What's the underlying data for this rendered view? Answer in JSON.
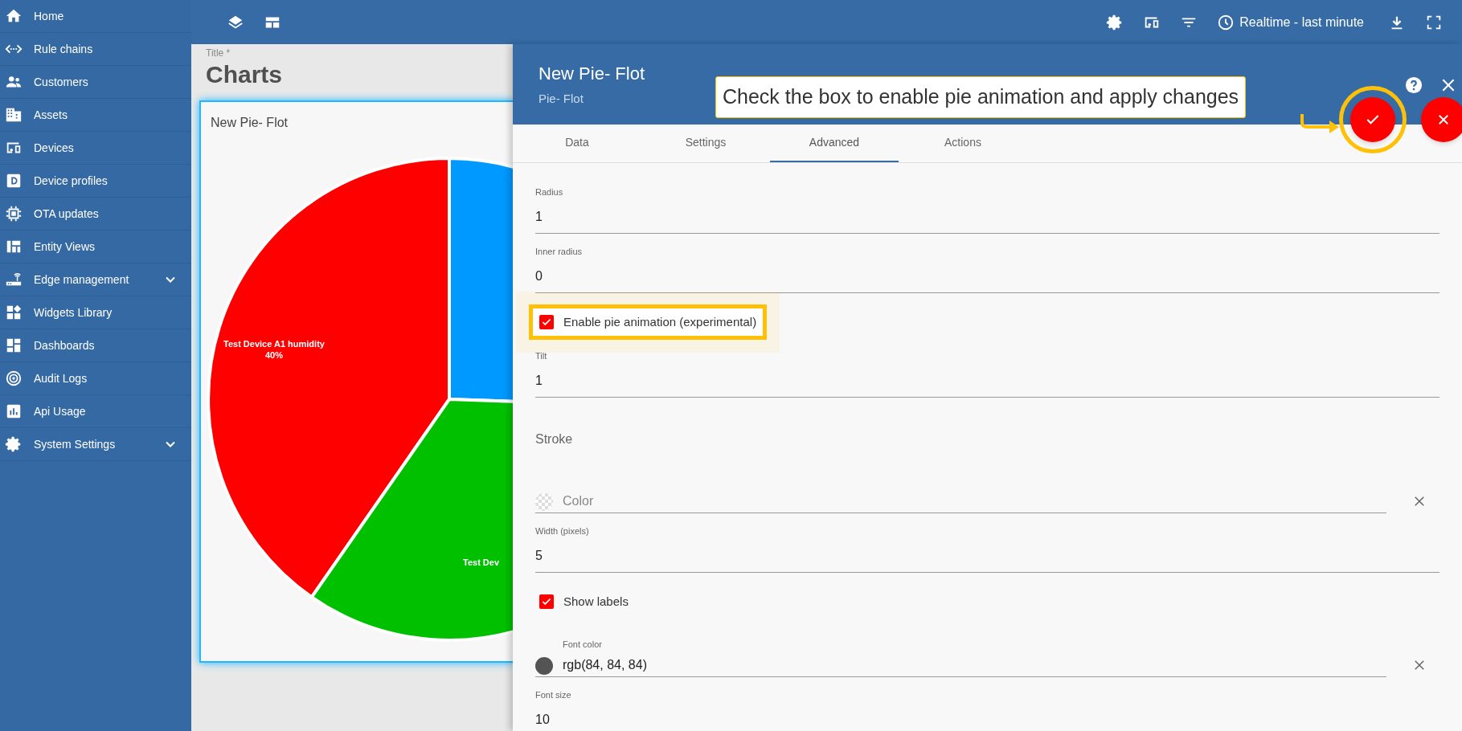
{
  "sidebar": {
    "items": [
      {
        "label": "Home",
        "expandable": false
      },
      {
        "label": "Rule chains",
        "expandable": false
      },
      {
        "label": "Customers",
        "expandable": false
      },
      {
        "label": "Assets",
        "expandable": false
      },
      {
        "label": "Devices",
        "expandable": false
      },
      {
        "label": "Device profiles",
        "expandable": false
      },
      {
        "label": "OTA updates",
        "expandable": false
      },
      {
        "label": "Entity Views",
        "expandable": false
      },
      {
        "label": "Edge management",
        "expandable": true
      },
      {
        "label": "Widgets Library",
        "expandable": false
      },
      {
        "label": "Dashboards",
        "expandable": false
      },
      {
        "label": "Audit Logs",
        "expandable": false
      },
      {
        "label": "Api Usage",
        "expandable": false
      },
      {
        "label": "System Settings",
        "expandable": true
      }
    ]
  },
  "toolbar": {
    "timewindow": "Realtime - last minute"
  },
  "dashboard": {
    "title_label": "Title *",
    "title": "Charts"
  },
  "widget": {
    "title": "New Pie- Flot",
    "slices": [
      {
        "color": "#ff0000",
        "label": "Test Device A1 humidity",
        "value_label": "40%"
      },
      {
        "color": "#0099ff"
      },
      {
        "color": "#00c000",
        "label": "Test Dev"
      }
    ]
  },
  "panel": {
    "title": "New Pie- Flot",
    "subtitle": "Pie- Flot",
    "tabs": [
      {
        "label": "Data",
        "selected": false
      },
      {
        "label": "Settings",
        "selected": false
      },
      {
        "label": "Advanced",
        "selected": true
      },
      {
        "label": "Actions",
        "selected": false
      }
    ],
    "fields": [
      {
        "kind": "text",
        "label": "Radius",
        "value": "1"
      },
      {
        "kind": "text",
        "label": "Inner radius",
        "value": "0"
      },
      {
        "kind": "checkbox",
        "label": "Enable pie animation (experimental)",
        "checked": true,
        "highlighted": true
      },
      {
        "kind": "text",
        "label": "Tilt",
        "value": "1"
      },
      {
        "kind": "section",
        "label": "Stroke"
      },
      {
        "kind": "color",
        "placeholder": "Color"
      },
      {
        "kind": "text",
        "label": "Width (pixels)",
        "value": "5"
      },
      {
        "kind": "checkbox",
        "label": "Show labels",
        "checked": true,
        "highlighted": false
      },
      {
        "kind": "color",
        "label": "Font color",
        "value": "rgb(84, 84, 84)"
      },
      {
        "kind": "text",
        "label": "Font size",
        "value": "10"
      }
    ]
  },
  "hint": {
    "text": "Check the box to enable pie animation and apply changes"
  }
}
